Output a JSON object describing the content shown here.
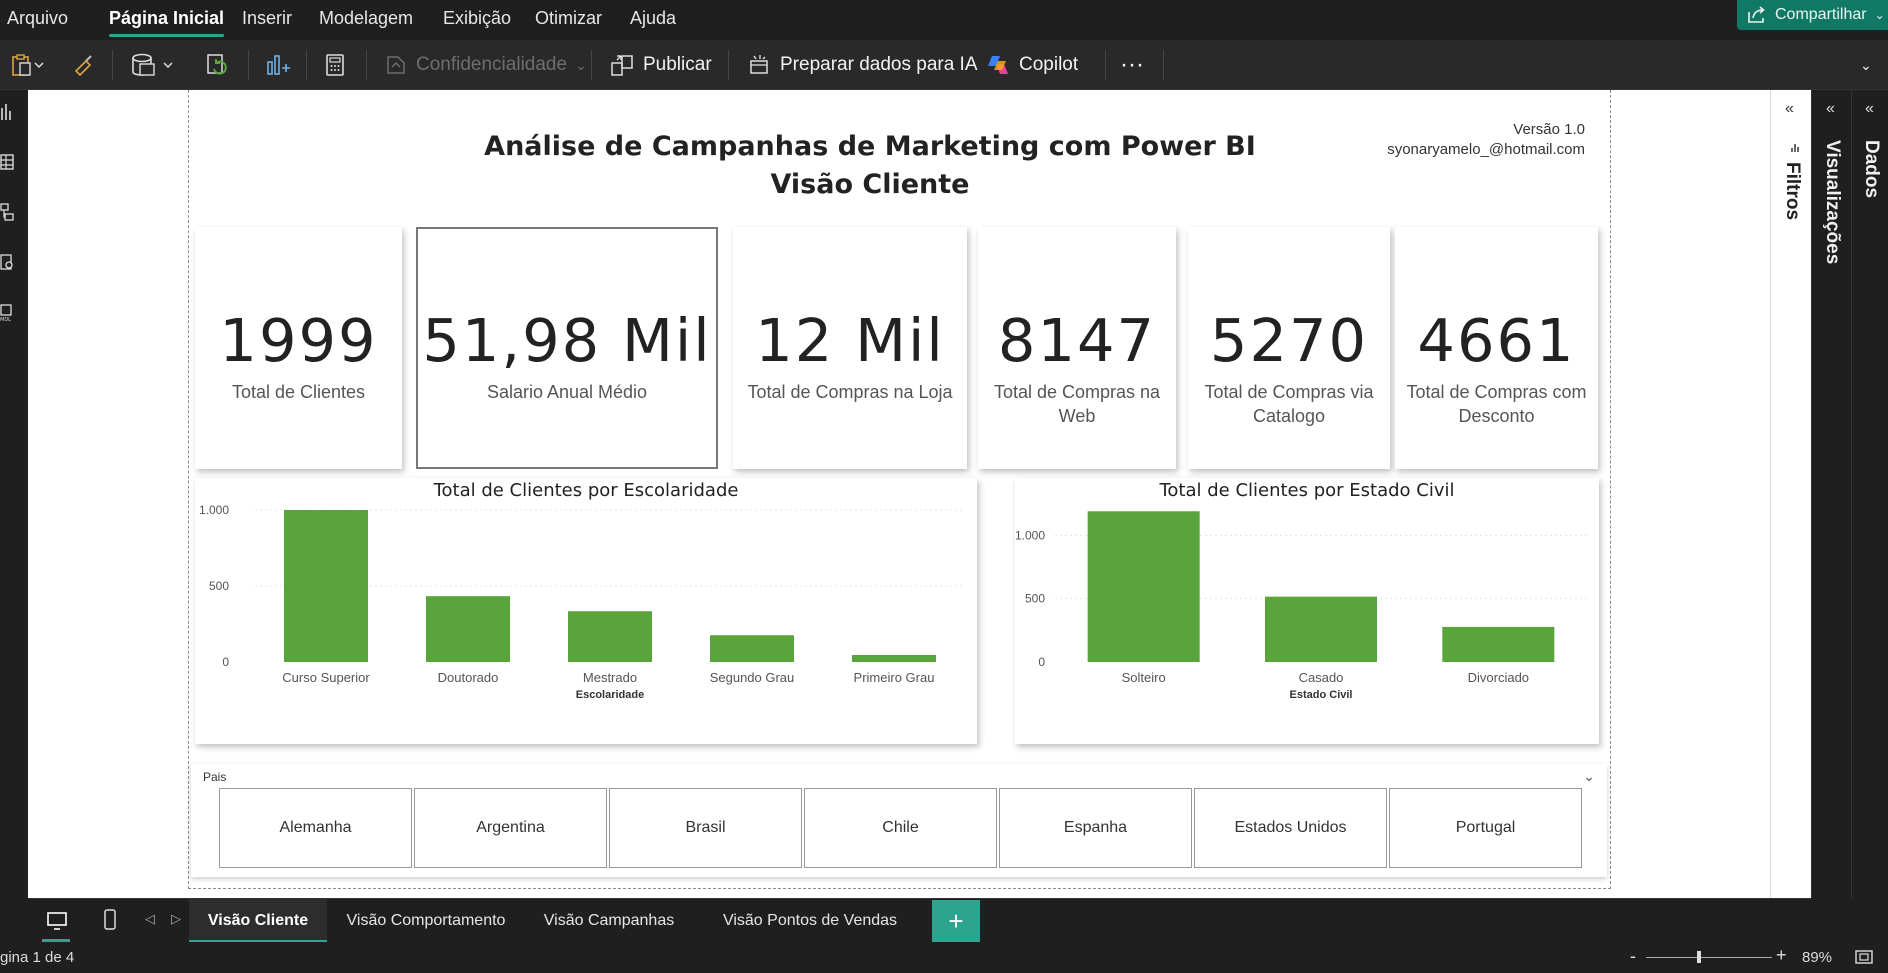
{
  "menu": {
    "items": [
      "Arquivo",
      "Página Inicial",
      "Inserir",
      "Modelagem",
      "Exibição",
      "Otimizar",
      "Ajuda"
    ],
    "share_label": "Compartilhar"
  },
  "ribbon": {
    "confidentiality": "Confidencialidade",
    "publish": "Publicar",
    "prepare_ai": "Preparar dados para IA",
    "copilot": "Copilot",
    "more": "···"
  },
  "report": {
    "title_line1": "Análise de Campanhas de Marketing com Power BI",
    "title_line2": "Visão Cliente",
    "version": "Versão 1.0",
    "email": "syonaryamelo_@hotmail.com"
  },
  "cards": [
    {
      "value": "1999",
      "label": "Total de Clientes"
    },
    {
      "value": "51,98 Mil",
      "label": "Salario Anual Médio"
    },
    {
      "value": "12 Mil",
      "label": "Total de Compras na Loja"
    },
    {
      "value": "8147",
      "label": "Total de Compras na Web"
    },
    {
      "value": "5270",
      "label": "Total de Compras via Catalogo"
    },
    {
      "value": "4661",
      "label": "Total de Compras com Desconto"
    }
  ],
  "chart_data": [
    {
      "type": "bar",
      "title": "Total de Clientes por Escolaridade",
      "xlabel": "Escolaridade",
      "ylabel": "",
      "categories": [
        "Curso Superior",
        "Doutorado",
        "Mestrado",
        "Segundo Grau",
        "Primeiro Grau"
      ],
      "values": [
        1000,
        433,
        334,
        176,
        46
      ],
      "ylim": [
        0,
        1000
      ],
      "yticks": [
        0,
        500,
        1000
      ],
      "ytick_labels": [
        "0",
        "500",
        "1.000"
      ],
      "color": "#5aa43c",
      "grid": true
    },
    {
      "type": "bar",
      "title": "Total de Clientes por Estado Civil",
      "xlabel": "Estado Civil",
      "ylabel": "",
      "categories": [
        "Solteiro",
        "Casado",
        "Divorciado"
      ],
      "values": [
        1190,
        516,
        277
      ],
      "ylim": [
        0,
        1200
      ],
      "yticks": [
        0,
        500,
        1000
      ],
      "ytick_labels": [
        "0",
        "500",
        "1.000"
      ],
      "color": "#5aa43c",
      "grid": true
    }
  ],
  "slicer": {
    "title": "Pais",
    "options": [
      "Alemanha",
      "Argentina",
      "Brasil",
      "Chile",
      "Espanha",
      "Estados Unidos",
      "Portugal"
    ]
  },
  "panes": {
    "filters": "Filtros",
    "visualizations": "Visualizações",
    "data": "Dados"
  },
  "tabs": [
    "Visão Cliente",
    "Visão Comportamento",
    "Visão Campanhas",
    "Visão Pontos de Vendas"
  ],
  "status": {
    "page": "gina 1 de 4",
    "zoom": "89%"
  },
  "colors": {
    "accent": "#2ba58f",
    "bar": "#5aa43c",
    "share": "#117865"
  }
}
